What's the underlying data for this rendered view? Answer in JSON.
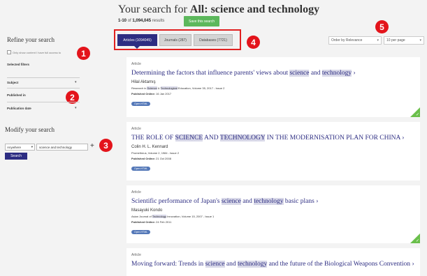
{
  "header": {
    "title_prefix": "Your search for ",
    "title_query": "All: science and technology",
    "range": "1-10",
    "of_word": "of",
    "total": "1,094,045",
    "results_word": "results",
    "save_label": "Save this search"
  },
  "tabs": [
    {
      "label": "Articles (1094045)"
    },
    {
      "label": "Journals (287)"
    },
    {
      "label": "Databases (7721)"
    }
  ],
  "order": {
    "selected": "Order by Relevance"
  },
  "per_page": {
    "selected": "10 per page"
  },
  "badges": [
    "1",
    "2",
    "3",
    "4",
    "5"
  ],
  "sidebar": {
    "refine_title": "Refine your search",
    "checkbox_label": "Only show content I have full access to",
    "selected_filters": "Selected filters",
    "filters": [
      "Subject",
      "Published in",
      "Publication date"
    ],
    "modify_title": "Modify your search",
    "field_select": "Anywhere",
    "query_value": "science and technology",
    "search_label": "Search"
  },
  "results": [
    {
      "type": "Article",
      "title_parts": [
        "Determining the factors that influence parents' views about ",
        "science",
        " and ",
        "technology"
      ],
      "author": "Hilal Aktamış",
      "source_parts": [
        "Research in ",
        "Science",
        " & ",
        "Technological",
        " Education, Volume 35, 2017 - Issue 2"
      ],
      "pub_label": "Published Online:",
      "pub_date": "16 Jan 2017",
      "html_label": "Open HTML"
    },
    {
      "type": "Article",
      "title_parts": [
        "THE ROLE OF ",
        "SCIENCE",
        " AND ",
        "TECHNOLOGY",
        " IN THE MODERNISATION PLAN FOR CHINA"
      ],
      "author": "Colin H. L. Kennard",
      "source_parts": [
        "Prometheus, Volume 2, 1984 - Issue 2"
      ],
      "pub_label": "Published Online:",
      "pub_date": "21 Oct 2008",
      "html_label": "Open HTML"
    },
    {
      "type": "Article",
      "title_parts": [
        "Scientific performance of Japan's ",
        "science",
        " and ",
        "technology",
        " basic plans"
      ],
      "author": "Masayuki Kondo",
      "source_parts": [
        "Asian Journal of ",
        "Technology",
        " Innovation, Volume 15, 2007 - Issue 1"
      ],
      "pub_label": "Published Online:",
      "pub_date": "24 Feb 2011",
      "html_label": "Open HTML"
    },
    {
      "type": "Article",
      "title_parts": [
        "Moving forward: Trends in ",
        "science",
        " and ",
        "technology",
        " and the future of the Biological Weapons Convention"
      ]
    }
  ],
  "icons": {
    "arrow": "chevron-right-icon",
    "plus": "plus-icon",
    "check": "check-icon"
  },
  "colors": {
    "brand": "#2d2d82",
    "save": "#5cb85c",
    "badge": "#e3141b",
    "access": "#6abf4b"
  }
}
